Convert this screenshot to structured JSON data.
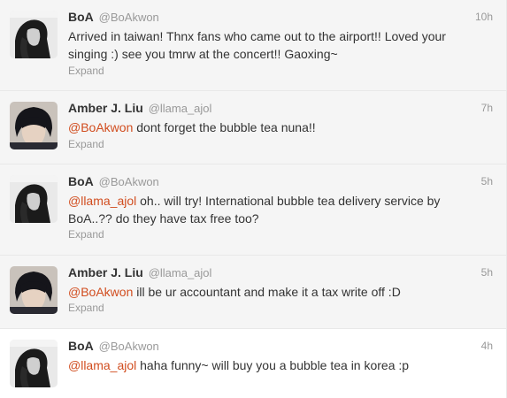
{
  "colors": {
    "mention": "#d14d1f",
    "name": "#333333",
    "meta": "#999999",
    "row_bg": "#f5f5f5"
  },
  "tweets": [
    {
      "name": "BoA",
      "handle": "@BoAkwon",
      "time": "10h",
      "mention": "",
      "text": "Arrived in taiwan! Thnx fans who came out to the airport!! Loved your singing :) see you tmrw at the concert!! Gaoxing~",
      "expand": "Expand",
      "avatar": "boa-avatar"
    },
    {
      "name": "Amber J. Liu",
      "handle": "@llama_ajol",
      "time": "7h",
      "mention": "@BoAkwon",
      "text": " dont forget the bubble tea nuna!!",
      "expand": "Expand",
      "avatar": "amber-avatar"
    },
    {
      "name": "BoA",
      "handle": "@BoAkwon",
      "time": "5h",
      "mention": "@llama_ajol",
      "text": " oh.. will try! International bubble tea delivery service by BoA..?? do they have tax free too?",
      "expand": "Expand",
      "avatar": "boa-avatar"
    },
    {
      "name": "Amber J. Liu",
      "handle": "@llama_ajol",
      "time": "5h",
      "mention": "@BoAkwon",
      "text": " ill be ur accountant and make it a tax write off :D",
      "expand": "Expand",
      "avatar": "amber-avatar"
    },
    {
      "name": "BoA",
      "handle": "@BoAkwon",
      "time": "4h",
      "mention": "@llama_ajol",
      "text": " haha funny~ will buy you a bubble tea in korea :p",
      "expand": "",
      "avatar": "boa-avatar"
    }
  ]
}
